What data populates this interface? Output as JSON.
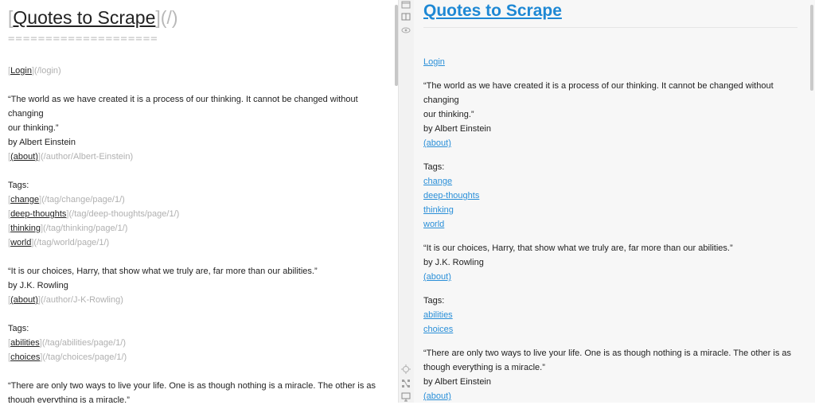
{
  "editor": {
    "h1_bracket_open": "[",
    "h1_title": "Quotes to Scrape",
    "h1_bracket_close": "]",
    "h1_url": "(/)",
    "h1_rule": "====================",
    "login": {
      "text": "Login",
      "url": "(/login)"
    },
    "quotes": [
      {
        "line1": "“The world as we have created it is a process of our thinking. It cannot be changed without changing",
        "line2": "our thinking.”",
        "by": "by Albert Einstein",
        "about_text": "(about)",
        "about_url": "(/author/Albert-Einstein)",
        "tags_label": "Tags:",
        "tags": [
          {
            "text": "change",
            "url": "(/tag/change/page/1/)"
          },
          {
            "text": "deep-thoughts",
            "url": "(/tag/deep-thoughts/page/1/)"
          },
          {
            "text": "thinking",
            "url": "(/tag/thinking/page/1/)"
          },
          {
            "text": "world",
            "url": "(/tag/world/page/1/)"
          }
        ]
      },
      {
        "line1": "“It is our choices, Harry, that show what we truly are, far more than our abilities.”",
        "by": "by J.K. Rowling",
        "about_text": "(about)",
        "about_url": "(/author/J-K-Rowling)",
        "tags_label": "Tags:",
        "tags": [
          {
            "text": "abilities",
            "url": "(/tag/abilities/page/1/)"
          },
          {
            "text": "choices",
            "url": "(/tag/choices/page/1/)"
          }
        ]
      },
      {
        "line1": "“There are only two ways to live your life. One is as though nothing is a miracle. The other is as",
        "line2": "though everything is a miracle.”"
      }
    ]
  },
  "preview": {
    "title": "Quotes to Scrape",
    "login": "Login",
    "quotes": [
      {
        "line1": "“The world as we have created it is a process of our thinking. It cannot be changed without changing",
        "line2": "our thinking.”",
        "by": "by Albert Einstein",
        "about": "(about)",
        "tags_label": "Tags:",
        "tags": [
          "change",
          "deep-thoughts",
          "thinking",
          "world"
        ]
      },
      {
        "line1": "“It is our choices, Harry, that show what we truly are, far more than our abilities.”",
        "by": "by J.K. Rowling",
        "about": "(about)",
        "tags_label": "Tags:",
        "tags": [
          "abilities",
          "choices"
        ]
      },
      {
        "line1": "“There are only two ways to live your life. One is as though nothing is a miracle. The other is as",
        "line2": "though everything is a miracle.”",
        "by": "by Albert Einstein",
        "about": "(about)"
      }
    ]
  },
  "colors": {
    "link": "#2a8fd8",
    "title_link": "#1e88d4",
    "muted": "#b0b0b0"
  },
  "icons": [
    "window-icon",
    "split-view-icon",
    "eye-icon",
    "crosshair-icon",
    "nodes-icon",
    "monitor-icon"
  ]
}
